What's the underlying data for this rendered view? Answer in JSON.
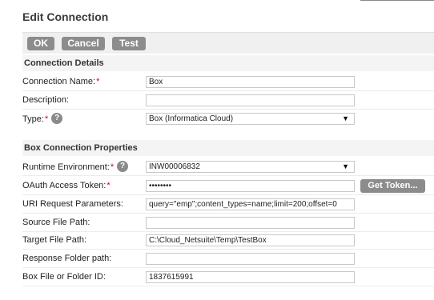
{
  "dialog": {
    "title": "Edit Connection"
  },
  "toolbar": {
    "ok_label": "OK",
    "cancel_label": "Cancel",
    "test_label": "Test"
  },
  "sections": {
    "details_title": "Connection Details",
    "properties_title": "Box Connection Properties"
  },
  "details": {
    "name": {
      "label": "Connection Name:",
      "required": "*",
      "value": "Box"
    },
    "description": {
      "label": "Description:",
      "value": ""
    },
    "type": {
      "label": "Type:",
      "required": "*",
      "help": "?",
      "value": "Box (Informatica Cloud)"
    }
  },
  "properties": {
    "runtime": {
      "label": "Runtime Environment:",
      "required": "*",
      "help": "?",
      "value": "INW00006832"
    },
    "oauth": {
      "label": "OAuth Access Token:",
      "required": "*",
      "value": "••••••••",
      "button": "Get Token..."
    },
    "uri": {
      "label": "URI Request Parameters:",
      "value": "query=\"emp\";content_types=name;limit=200;offset=0"
    },
    "source": {
      "label": "Source File Path:",
      "value": ""
    },
    "target": {
      "label": "Target File Path:",
      "value": "C:\\Cloud_Netsuite\\Temp\\TestBox"
    },
    "response": {
      "label": "Response Folder path:",
      "value": ""
    },
    "box_id": {
      "label": "Box File or Folder ID:",
      "value": "1837615991"
    }
  },
  "icons": {
    "dropdown": "chevron-down-icon",
    "help": "help-circle-icon"
  },
  "colors": {
    "button_bg": "#8c8c8c",
    "required": "#d0021b",
    "section_bg": "#f4f4f4"
  }
}
